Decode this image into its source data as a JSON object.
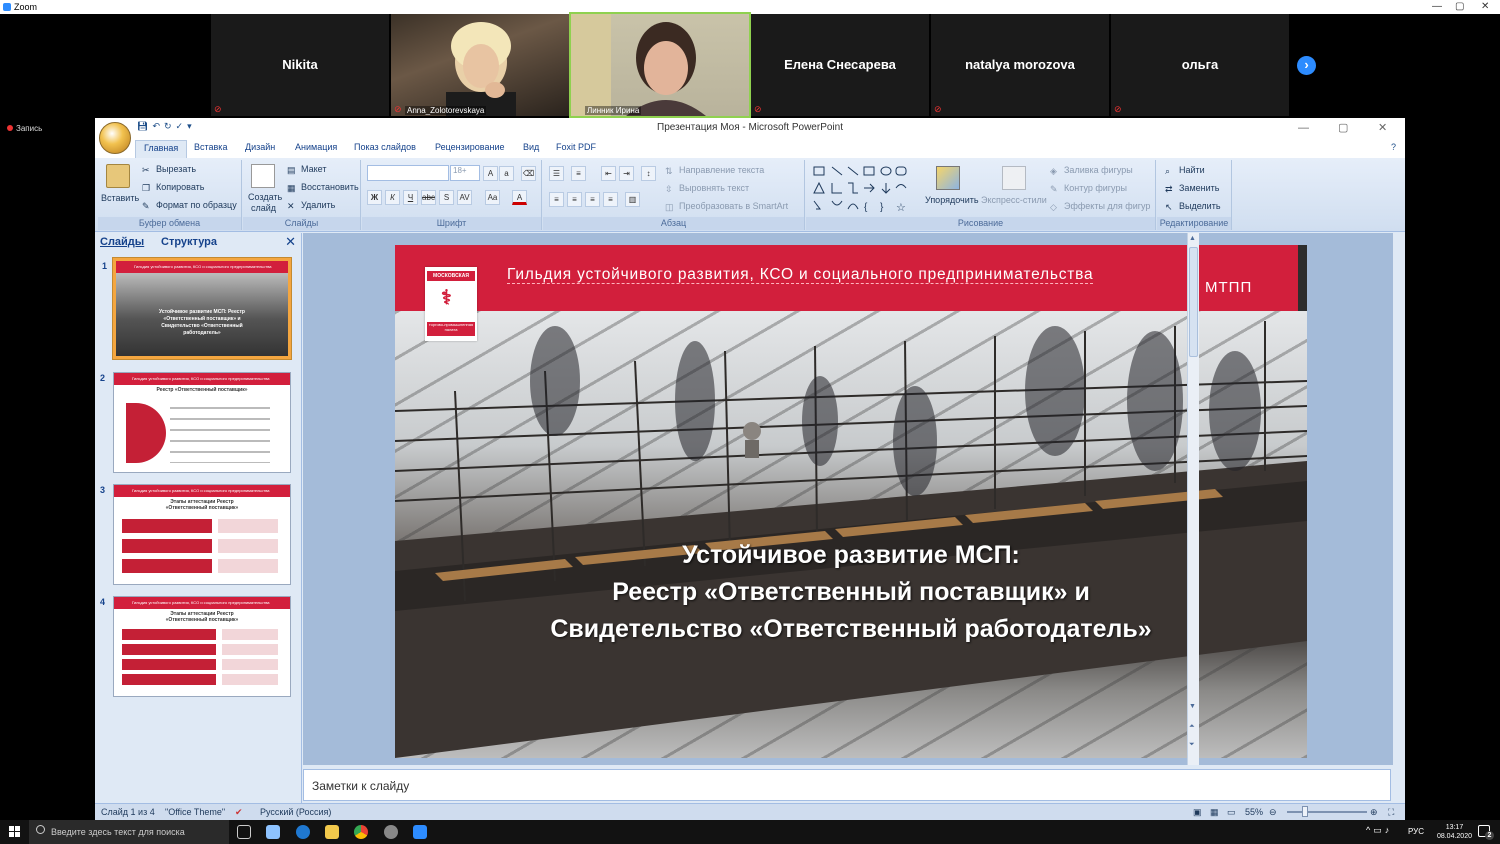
{
  "zoom": {
    "window_title": "Zoom",
    "record_label": "Запись",
    "participants": [
      {
        "name": "Nikita",
        "video": false
      },
      {
        "name": "Anna_Zolotorevskaya",
        "video": true
      },
      {
        "name": "Линник Ирина",
        "video": true
      },
      {
        "name": "Елена Снесарева",
        "video": false
      },
      {
        "name": "natalya morozova",
        "video": false
      },
      {
        "name": "ольга",
        "video": false
      }
    ],
    "next_button": "›"
  },
  "ppt": {
    "title": "Презентация Моя - Microsoft PowerPoint",
    "tabs": [
      "Главная",
      "Вставка",
      "Дизайн",
      "Анимация",
      "Показ слайдов",
      "Рецензирование",
      "Вид",
      "Foxit PDF"
    ],
    "ribbon": {
      "clipboard": {
        "paste": "Вставить",
        "cut": "Вырезать",
        "copy": "Копировать",
        "format": "Формат по образцу",
        "label": "Буфер обмена"
      },
      "slides": {
        "new_slide_1": "Создать",
        "new_slide_2": "слайд",
        "layout": "Макет",
        "reset": "Восстановить",
        "delete": "Удалить",
        "label": "Слайды"
      },
      "font": {
        "size": "18+",
        "label": "Шрифт"
      },
      "paragraph": {
        "direction": "Направление текста",
        "align": "Выровнять текст",
        "smartart": "Преобразовать в SmartArt",
        "label": "Абзац"
      },
      "drawing": {
        "arrange": "Упорядочить",
        "styles": "Экспресс-стили",
        "fill": "Заливка фигуры",
        "outline": "Контур фигуры",
        "effects": "Эффекты для фигур",
        "label": "Рисование"
      },
      "editing": {
        "find": "Найти",
        "replace": "Заменить",
        "select": "Выделить",
        "label": "Редактирование"
      }
    },
    "left_pane": {
      "tab_slides": "Слайды",
      "tab_outline": "Структура",
      "close": "✕",
      "thumbs": [
        {
          "num": "1",
          "header": "Гильдия устойчивого развития, КСО и социального предпринимательства",
          "body": "Устойчивое развитие МСП: Реестр «Ответственный поставщик» и Свидетельство «Ответственный работодатель»"
        },
        {
          "num": "2",
          "header": "Гильдия устойчивого развития, КСО и социального предпринимательства",
          "body": "Реестр «Ответственный поставщик»"
        },
        {
          "num": "3",
          "header": "Гильдия устойчивого развития, КСО и социального предпринимательства",
          "body": "Этапы аттестации Реестр «Ответственный поставщик»"
        },
        {
          "num": "4",
          "header": "Гильдия устойчивого развития, КСО и социального предпринимательства",
          "body": "Этапы аттестации Реестр «Ответственный поставщик»"
        }
      ]
    },
    "slide": {
      "header": "Гильдия устойчивого развития, КСО и социального предпринимательства",
      "org": "МТПП",
      "logo_top": "МОСКОВСКАЯ",
      "logo_bottom": "торгово-промышленная палата",
      "title_1": "Устойчивое развитие МСП:",
      "title_2": "Реестр «Ответственный поставщик» и",
      "title_3": "Свидетельство «Ответственный работодатель»"
    },
    "notes_placeholder": "Заметки к слайду",
    "status": {
      "slide_counter": "Слайд 1 из 4",
      "theme": "\"Office Theme\"",
      "language": "Русский (Россия)",
      "zoom": "55%"
    }
  },
  "taskbar": {
    "search_placeholder": "Введите здесь текст для поиска",
    "lang": "РУС",
    "time": "13:17",
    "date": "08.04.2020",
    "notif_count": "2"
  },
  "colors": {
    "brand_red": "#d21f3c",
    "zoom_blue": "#2d8cff",
    "office_blue": "#15428b"
  }
}
